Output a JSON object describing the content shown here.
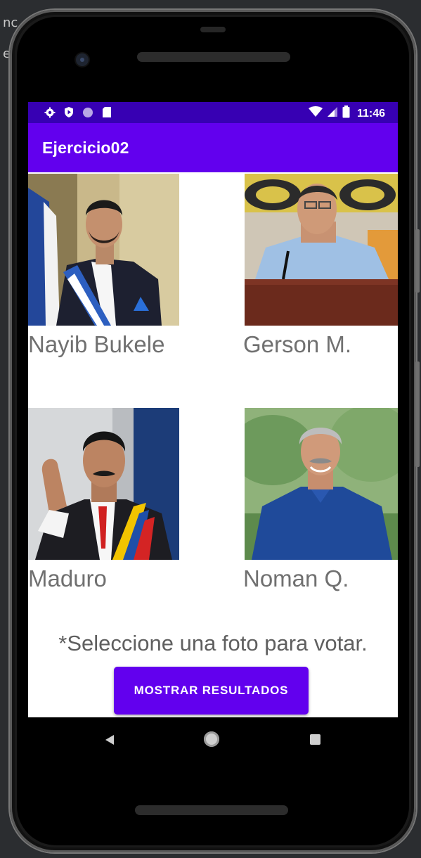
{
  "ide": {
    "lines": [
      "nc",
      "e"
    ]
  },
  "status_bar": {
    "time": "11:46",
    "left_icons": [
      "gear-icon",
      "shield-play-icon",
      "circle-notification-icon",
      "sd-card-icon"
    ],
    "right_icons": [
      "wifi-icon",
      "signal-icon",
      "battery-icon"
    ]
  },
  "app_bar": {
    "title": "Ejercicio02"
  },
  "candidates": [
    {
      "name": "Nayib Bukele"
    },
    {
      "name": "Gerson M."
    },
    {
      "name": "Maduro"
    },
    {
      "name": "Noman Q."
    }
  ],
  "hint": "*Seleccione una foto para votar.",
  "button": {
    "label": "MOSTRAR RESULTADOS"
  },
  "colors": {
    "primary": "#6200ee",
    "primary_dark": "#3700b3",
    "text_gray": "#707070"
  },
  "nav": {
    "icons": [
      "back-icon",
      "home-icon",
      "recents-icon"
    ]
  }
}
